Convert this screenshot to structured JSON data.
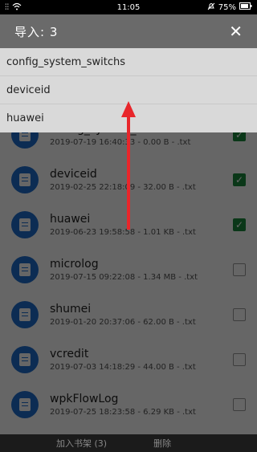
{
  "statusbar": {
    "signal": "⫶⫶",
    "time": "11:05",
    "battery": "75%"
  },
  "header": {
    "title": "导入: 3",
    "close": "✕"
  },
  "menu": [
    {
      "label": "config_system_switchs"
    },
    {
      "label": "deviceid"
    },
    {
      "label": "huawei"
    }
  ],
  "files": [
    {
      "name": "config_system_switchs",
      "meta": "2019-07-19 16:40:33 - 0.00 B - .txt",
      "checked": true
    },
    {
      "name": "deviceid",
      "meta": "2019-02-25 22:18:09 - 32.00 B - .txt",
      "checked": true
    },
    {
      "name": "huawei",
      "meta": "2019-06-23 19:58:58 - 1.01 KB - .txt",
      "checked": true
    },
    {
      "name": "microlog",
      "meta": "2019-07-15 09:22:08 - 1.34 MB - .txt",
      "checked": false
    },
    {
      "name": "shumei",
      "meta": "2019-01-20 20:37:06 - 62.00 B - .txt",
      "checked": false
    },
    {
      "name": "vcredit",
      "meta": "2019-07-03 14:18:29 - 44.00 B - .txt",
      "checked": false
    },
    {
      "name": "wpkFlowLog",
      "meta": "2019-07-25 18:23:58 - 6.29 KB - .txt",
      "checked": false
    }
  ],
  "bottombar": {
    "add_label": "加入书架 (3)",
    "delete_label": "删除"
  },
  "colors": {
    "header": "#6a6a6a",
    "menu": "#d9d9d9",
    "icon": "#1f6fd0",
    "check": "#1a8a3c",
    "arrow": "#e8262b"
  }
}
